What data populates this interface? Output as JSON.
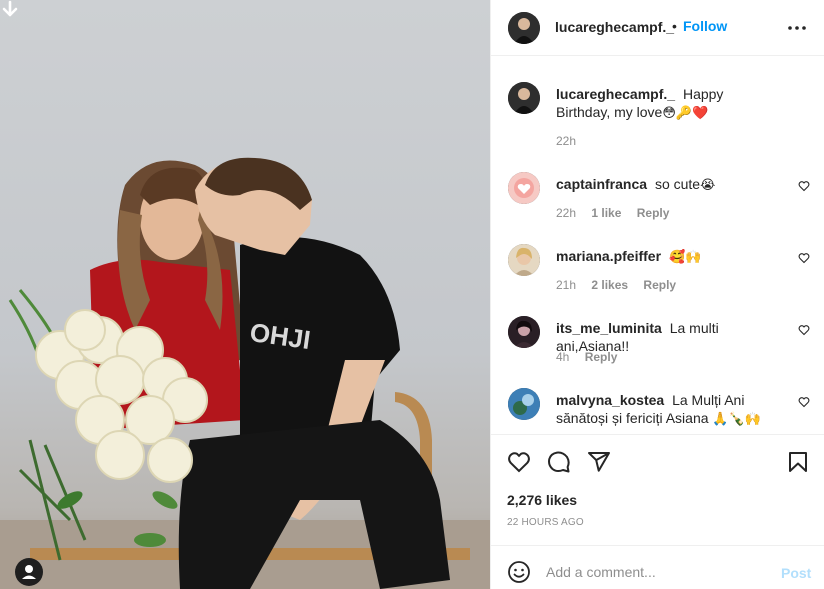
{
  "post": {
    "author": "lucareghecampf._",
    "follow_label": "Follow",
    "dot": "•",
    "more_icon": "more-options-icon",
    "caption": {
      "username": "lucareghecampf._",
      "text": "Happy Birthday, my love",
      "emoji": "😳🔑❤️",
      "time": "22h"
    }
  },
  "comments": [
    {
      "username": "captainfranca",
      "text": "so cute",
      "emoji": "😭",
      "time": "22h",
      "likes": "1 like",
      "reply": "Reply"
    },
    {
      "username": "mariana.pfeiffer",
      "text": "",
      "emoji": "🥰🙌",
      "time": "21h",
      "likes": "2 likes",
      "reply": "Reply"
    },
    {
      "username": "its_me_luminita",
      "text": "La multi ani,Asiana!!",
      "emoji": "",
      "time": "4h",
      "likes": "",
      "reply": "Reply"
    },
    {
      "username": "malvyna_kostea",
      "text": "La Mulți Ani sănătoși și fericiți Asiana",
      "emoji": "🙏🍾🙌",
      "time": "",
      "likes": "",
      "reply": ""
    }
  ],
  "actions": {
    "likes": "2,276 likes",
    "posted": "22 HOURS AGO"
  },
  "add_comment": {
    "placeholder": "Add a comment...",
    "post_label": "Post"
  },
  "colors": {
    "accent": "#0095f6",
    "post_disabled": "#b2dffc",
    "muted": "#8e8e8e",
    "border": "#efefef"
  },
  "icons": [
    "download-arrow-icon",
    "tag-user-icon",
    "like-heart-icon",
    "comment-icon",
    "share-icon",
    "save-icon",
    "emoji-icon"
  ]
}
